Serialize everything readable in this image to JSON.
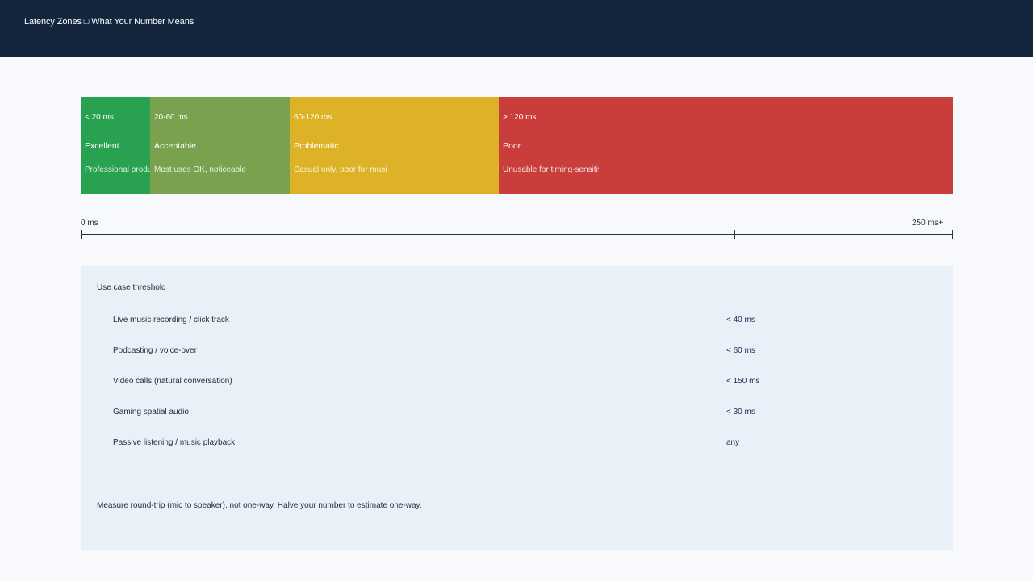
{
  "header": {
    "title": "Latency Zones □ What Your Number Means"
  },
  "zones": [
    {
      "range": "< 20 ms",
      "label": "Excellent",
      "description": "Professional production",
      "color": "#28a150"
    },
    {
      "range": "20-60 ms",
      "label": "Acceptable",
      "description": "Most uses OK, noticeable",
      "color": "#7aa24e"
    },
    {
      "range": "60-120 ms",
      "label": "Problematic",
      "description": "Casual only, poor for music",
      "color": "#ddb226"
    },
    {
      "range": "> 120 ms",
      "label": "Poor",
      "description": "Unusable for timing-sensitive work",
      "color": "#c93d3b"
    }
  ],
  "axis": {
    "min_label": "0 ms",
    "max_label": "250 ms+"
  },
  "thresholds": {
    "heading": "Use case threshold",
    "rows": [
      {
        "use_case": "Live music recording / click track",
        "threshold": "< 40 ms"
      },
      {
        "use_case": "Podcasting / voice-over",
        "threshold": "< 60 ms"
      },
      {
        "use_case": "Video calls (natural conversation)",
        "threshold": "< 150 ms"
      },
      {
        "use_case": "Gaming spatial audio",
        "threshold": "< 30 ms"
      },
      {
        "use_case": "Passive listening / music playback",
        "threshold": "any"
      }
    ],
    "footnote": "Measure round-trip (mic to speaker), not one-way. Halve your number to estimate one-way."
  }
}
